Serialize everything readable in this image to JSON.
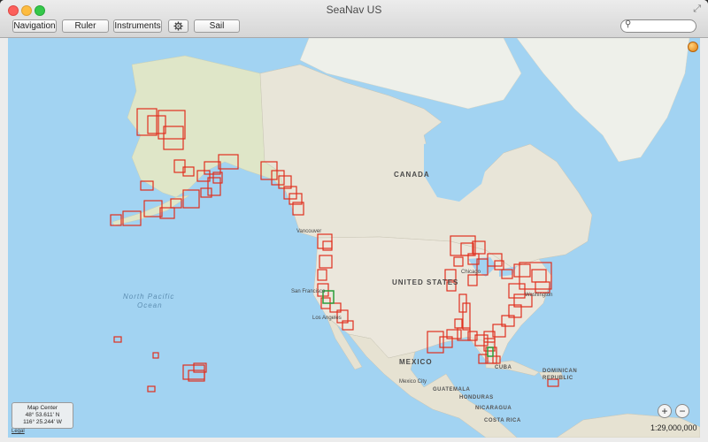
{
  "window": {
    "title": "SeaNav US"
  },
  "toolbar": {
    "navigation": "Navigation",
    "ruler": "Ruler",
    "instruments": "Instruments",
    "settings_icon": "gear-icon",
    "sail": "Sail"
  },
  "search": {
    "value": "",
    "placeholder": "",
    "icon": "search-icon"
  },
  "map": {
    "labels": {
      "canada": "CANADA",
      "united_states": "UNITED STATES",
      "mexico": "MEXICO",
      "north_pacific": "North Pacific",
      "ocean": "Ocean",
      "cuba": "CUBA",
      "dominican": "DOMINICAN",
      "republic": "REPUBLIC",
      "guatemala": "GUATEMALA",
      "honduras": "HONDURAS",
      "nicaragua": "NICARAGUA",
      "costa_rica": "COSTA RICA",
      "vancouver": "Vancouver",
      "san_francisco": "San Francisco",
      "los_angeles": "Los Angeles",
      "chicago": "Chicago",
      "washington": "Washington",
      "mexico_city": "Mexico City"
    },
    "center": {
      "title": "Map Center",
      "lat": "48° 53.611' N",
      "lon": "116° 25.244' W"
    },
    "legal": "Legal",
    "scale": "1:29,000,000",
    "zoom_in": "+",
    "zoom_out": "−",
    "colors": {
      "water": "#a2d3f2",
      "land": "#e8e5d8",
      "chart_outline": "#e0301e",
      "selected_chart": "#2a9d3a"
    }
  }
}
